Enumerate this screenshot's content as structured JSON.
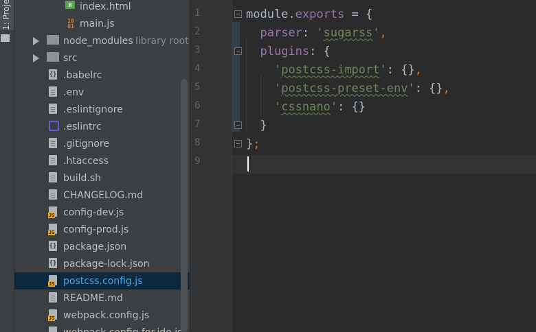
{
  "toolwindow": {
    "project_tab_label": "1: Proje"
  },
  "tree": {
    "items": [
      {
        "label": "index.html",
        "icon": "html-file-icon",
        "indent": 1
      },
      {
        "label": "main.js",
        "icon": "js-main-file-icon",
        "indent": 1
      },
      {
        "label": "node_modules",
        "hint": "library root",
        "icon": "folder-icon",
        "arrow": true
      },
      {
        "label": "src",
        "icon": "folder-icon",
        "arrow": true
      },
      {
        "label": ".babelrc",
        "icon": "json-file-icon"
      },
      {
        "label": ".env",
        "icon": "text-file-icon"
      },
      {
        "label": ".eslintignore",
        "icon": "text-file-icon"
      },
      {
        "label": ".eslintrc",
        "icon": "eslint-icon"
      },
      {
        "label": ".gitignore",
        "icon": "text-file-icon"
      },
      {
        "label": ".htaccess",
        "icon": "text-file-icon"
      },
      {
        "label": "build.sh",
        "icon": "text-file-icon"
      },
      {
        "label": "CHANGELOG.md",
        "icon": "text-file-icon"
      },
      {
        "label": "config-dev.js",
        "icon": "js-file-icon"
      },
      {
        "label": "config-prod.js",
        "icon": "js-file-icon"
      },
      {
        "label": "package.json",
        "icon": "json-file-icon"
      },
      {
        "label": "package-lock.json",
        "icon": "json-file-icon"
      },
      {
        "label": "postcss.config.js",
        "icon": "js-file-icon",
        "selected": true
      },
      {
        "label": "README.md",
        "icon": "text-file-icon"
      },
      {
        "label": "webpack.config.js",
        "icon": "js-file-icon"
      },
      {
        "label": "webpack.config.for.ide.js",
        "icon": "js-file-icon"
      }
    ]
  },
  "editor": {
    "line_numbers": [
      "1",
      "2",
      "3",
      "4",
      "5",
      "6",
      "7",
      "8",
      "9"
    ],
    "lines": [
      {
        "parts": [
          [
            "plain",
            "module."
          ],
          [
            "key",
            "exports"
          ],
          [
            "plain",
            " = {"
          ]
        ]
      },
      {
        "parts": [
          [
            "plain",
            "  "
          ],
          [
            "key",
            "parser"
          ],
          [
            "plain",
            ": "
          ],
          [
            "q",
            "'"
          ],
          [
            "str",
            "sugarss"
          ],
          [
            "q",
            "'"
          ],
          [
            "punc",
            ","
          ]
        ]
      },
      {
        "parts": [
          [
            "plain",
            "  "
          ],
          [
            "key",
            "plugins"
          ],
          [
            "plain",
            ": {"
          ]
        ]
      },
      {
        "parts": [
          [
            "plain",
            "    "
          ],
          [
            "q",
            "'"
          ],
          [
            "str",
            "postcss-import"
          ],
          [
            "q",
            "'"
          ],
          [
            "plain",
            ": {}"
          ],
          [
            "punc",
            ","
          ]
        ]
      },
      {
        "parts": [
          [
            "plain",
            "    "
          ],
          [
            "q",
            "'"
          ],
          [
            "str",
            "postcss-preset-env"
          ],
          [
            "q",
            "'"
          ],
          [
            "plain",
            ": {}"
          ],
          [
            "punc",
            ","
          ]
        ]
      },
      {
        "parts": [
          [
            "plain",
            "    "
          ],
          [
            "q",
            "'"
          ],
          [
            "str",
            "cssnano"
          ],
          [
            "q",
            "'"
          ],
          [
            "plain",
            ": {}"
          ]
        ]
      },
      {
        "parts": [
          [
            "plain",
            "  }"
          ]
        ]
      },
      {
        "parts": [
          [
            "plain",
            "}"
          ],
          [
            "punc",
            ";"
          ]
        ]
      },
      {
        "parts": []
      }
    ]
  }
}
